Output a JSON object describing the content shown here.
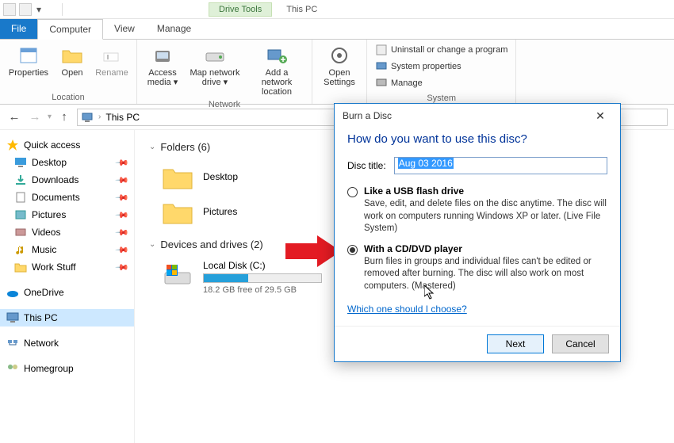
{
  "titlebar": {
    "contextual_tab": "Drive Tools",
    "location_tab": "This PC"
  },
  "ribbon_tabs": {
    "file": "File",
    "computer": "Computer",
    "view": "View",
    "manage": "Manage"
  },
  "ribbon": {
    "location_group": "Location",
    "properties": "Properties",
    "open": "Open",
    "rename": "Rename",
    "network_group": "Network",
    "access_media": "Access media ▾",
    "map_drive": "Map network drive ▾",
    "add_location": "Add a network location",
    "open_settings": "Open Settings",
    "system_group": "System",
    "uninstall": "Uninstall or change a program",
    "system_props": "System properties",
    "manage": "Manage"
  },
  "address": {
    "crumb": "This PC"
  },
  "sidebar": {
    "quick_access": "Quick access",
    "items": [
      {
        "label": "Desktop"
      },
      {
        "label": "Downloads"
      },
      {
        "label": "Documents"
      },
      {
        "label": "Pictures"
      },
      {
        "label": "Videos"
      },
      {
        "label": "Music"
      },
      {
        "label": "Work Stuff"
      }
    ],
    "onedrive": "OneDrive",
    "thispc": "This PC",
    "network": "Network",
    "homegroup": "Homegroup"
  },
  "content": {
    "folders_header": "Folders (6)",
    "folders": [
      {
        "label": "Desktop"
      },
      {
        "label": "Pictures"
      }
    ],
    "devices_header": "Devices and drives (2)",
    "drive": {
      "label": "Local Disk (C:)",
      "free": "18.2 GB free of 29.5 GB"
    }
  },
  "dialog": {
    "title": "Burn a Disc",
    "heading": "How do you want to use this disc?",
    "disc_title_label": "Disc title:",
    "disc_title_value": "Aug 03 2016",
    "opt_usb_label": "Like a USB flash drive",
    "opt_usb_desc": "Save, edit, and delete files on the disc anytime. The disc will work on computers running Windows XP or later. (Live File System)",
    "opt_cd_label": "With a CD/DVD player",
    "opt_cd_desc": "Burn files in groups and individual files can't be edited or removed after burning. The disc will also work on most computers. (Mastered)",
    "help_link": "Which one should I choose?",
    "next": "Next",
    "cancel": "Cancel"
  }
}
